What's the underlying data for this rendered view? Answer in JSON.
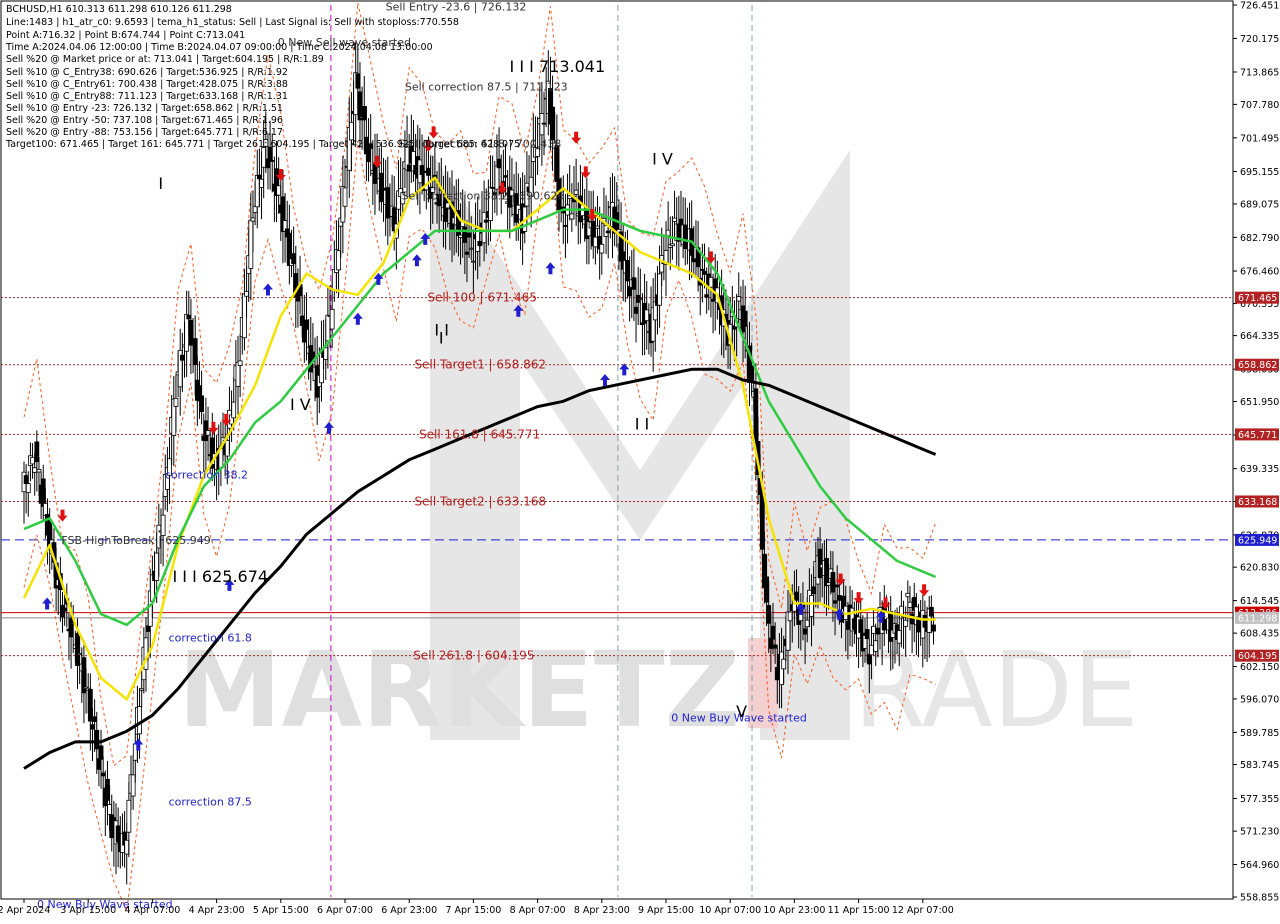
{
  "info": {
    "lines": [
      "BCHUSD,H1  610.313 611.298 610.126 611.298",
      "Line:1483  | h1_atr_c0: 9.6593  | tema_h1_status: Sell  | Last Signal is: Sell with stoploss:770.558",
      "Point A:716.32  | Point B:674.744  | Point C:713.041",
      "Time A:2024.04.06 12:00:00  | Time B:2024.04.07 09:00:00  | Time C:2024.04.08 13:00:00",
      "Sell %20 @ Market price or at: 713.041  | Target:604.195  | R/R:1.89",
      "Sell %10 @ C_Entry38: 690.626  | Target:536.925  | R/R:1.92",
      "Sell %10 @ C_Entry61: 700.438  | Target:428.075  | R/R:3.88",
      "Sell %10 @ C_Entry88: 711.123  | Target:633.168  | R/R:1.31",
      "Sell %10 @ Entry -23: 726.132  | Target:658.862  | R/R:1.51",
      "Sell %20 @ Entry -50: 737.108  | Target:671.465  | R/R:1.96",
      "Sell %20 @ Entry -88: 753.156  | Target:645.771  | R/R:6.17",
      "Target100: 671.465  | Target 161: 645.771  | Target 261: 604.195  | Target 423: 536.925  | Target 685: 428.075"
    ]
  },
  "watermark": {
    "brand": "MARKETZI",
    "suffix": "TRADE"
  },
  "annotations": [
    {
      "text": "Sell Entry -23.6 | 726.132",
      "price": 726.132,
      "time": 6.1,
      "style": "dark"
    },
    {
      "text": "0 New Sell wave started",
      "price": 719.5,
      "time": 4.42,
      "style": "dark"
    },
    {
      "text": "Sell correction 87.5 | 711.123",
      "price": 711.123,
      "time": 6.4,
      "style": "dark"
    },
    {
      "text": "Sell correction 61.8 | 700.438",
      "price": 700.438,
      "time": 6.3,
      "style": "dark"
    },
    {
      "text": "Sell correction 38.2 | 690.626",
      "price": 690.626,
      "time": 6.35,
      "style": "dark"
    },
    {
      "text": "Sell 100 | 671.465",
      "price": 671.465,
      "time": 6.75,
      "style": "red"
    },
    {
      "text": "Sell Target1 | 658.862",
      "price": 658.862,
      "time": 6.55,
      "style": "red"
    },
    {
      "text": "Sell 161.8 | 645.771",
      "price": 645.771,
      "time": 6.62,
      "style": "red"
    },
    {
      "text": "Sell Target2 | 633.168",
      "price": 633.168,
      "time": 6.55,
      "style": "red"
    },
    {
      "text": "Sell  261.8 | 604.195",
      "price": 604.195,
      "time": 6.53,
      "style": "red"
    },
    {
      "text": "FSB-HighToBreak | 625.949",
      "price": 625.949,
      "time": 1.05,
      "style": "dark"
    },
    {
      "text": "correction 38.2",
      "price": 638.2,
      "time": 2.66,
      "style": "blue"
    },
    {
      "text": "correction 61.8",
      "price": 607.6,
      "time": 2.72,
      "style": "blue"
    },
    {
      "text": "correction 87.5",
      "price": 576.8,
      "time": 2.72,
      "style": "blue"
    },
    {
      "text": "0 New Buy Wave started",
      "price": 557.5,
      "time": 0.67,
      "style": "blue"
    },
    {
      "text": "0 New Buy Wave started",
      "price": 592.6,
      "time": 10.55,
      "style": "blue"
    }
  ],
  "wave_labels": [
    {
      "text": "I I I 713.041",
      "price": 715.0,
      "time": 7.75,
      "color": "#000000"
    },
    {
      "text": "I I I 625.674",
      "price": 619.2,
      "time": 2.5,
      "color": "#1f1fd0"
    },
    {
      "text": "I V",
      "price": 651.5,
      "time": 4.33,
      "color": "#1f1fd0"
    },
    {
      "text": "I V",
      "price": 697.6,
      "time": 9.97,
      "color": "#000000"
    },
    {
      "text": "I I",
      "price": 665.5,
      "time": 6.58,
      "color": "#000000"
    },
    {
      "text": "I I",
      "price": 647.8,
      "time": 9.7,
      "color": "#000000"
    },
    {
      "text": "V",
      "price": 593.8,
      "time": 11.28,
      "color": "#000000"
    },
    {
      "text": "I",
      "price": 693.0,
      "time": 2.28,
      "color": "#1f1fd0"
    },
    {
      "text": "I",
      "price": 664.0,
      "time": 6.65,
      "color": "#000000"
    }
  ],
  "price_tags": [
    {
      "label": "671.465",
      "price": 671.465,
      "color": "#b22222"
    },
    {
      "label": "658.862",
      "price": 658.862,
      "color": "#b22222"
    },
    {
      "label": "645.771",
      "price": 645.771,
      "color": "#b22222"
    },
    {
      "label": "633.168",
      "price": 633.168,
      "color": "#b22222"
    },
    {
      "label": "625.949",
      "price": 625.949,
      "color": "#1f1fd0"
    },
    {
      "label": "612.286",
      "price": 612.286,
      "color": "#cc0000"
    },
    {
      "label": "611.298",
      "price": 611.298,
      "color": "#c0c0c0"
    },
    {
      "label": "604.195",
      "price": 604.195,
      "color": "#b22222"
    }
  ],
  "chart_data": {
    "type": "line",
    "symbol": "BCHUSD",
    "timeframe": "H1",
    "y_axis": {
      "min": 558.855,
      "max": 726.451,
      "ticks": [
        "726.451",
        "720.175",
        "713.865",
        "707.780",
        "701.495",
        "695.155",
        "689.075",
        "682.790",
        "676.460",
        "670.355",
        "664.335",
        "658.030",
        "651.950",
        "645.665",
        "639.335",
        "633.155",
        "626.870",
        "620.830",
        "614.545",
        "608.435",
        "602.150",
        "596.070",
        "589.785",
        "583.745",
        "577.355",
        "571.230",
        "564.960",
        "558.855"
      ]
    },
    "x_axis": {
      "labels": [
        "2 Apr 2024",
        "3 Apr 15:00",
        "4 Apr 07:00",
        "4 Apr 23:00",
        "5 Apr 15:00",
        "6 Apr 07:00",
        "6 Apr 23:00",
        "7 Apr 15:00",
        "8 Apr 07:00",
        "8 Apr 23:00",
        "9 Apr 15:00",
        "10 Apr 07:00",
        "10 Apr 23:00",
        "11 Apr 15:00",
        "12 Apr 07:00"
      ]
    },
    "levels": [
      {
        "name": "Sell 100",
        "value": 671.465,
        "color": "#b22222",
        "style": "dotted"
      },
      {
        "name": "Sell Target1",
        "value": 658.862,
        "color": "#b22222",
        "style": "dotted"
      },
      {
        "name": "Sell 161.8",
        "value": 645.771,
        "color": "#b22222",
        "style": "dotted"
      },
      {
        "name": "Sell Target2",
        "value": 633.168,
        "color": "#b22222",
        "style": "dotted"
      },
      {
        "name": "FSB-HighToBreak",
        "value": 625.949,
        "color": "#1f1fd0",
        "style": "dashed"
      },
      {
        "name": "Stop",
        "value": 612.286,
        "color": "#cc0000",
        "style": "solid"
      },
      {
        "name": "Last",
        "value": 611.298,
        "color": "#888888",
        "style": "solid"
      },
      {
        "name": "Sell 261.8",
        "value": 604.195,
        "color": "#b22222",
        "style": "dotted"
      }
    ],
    "vertical_markers": [
      {
        "time": 4.78,
        "color": "#cc00cc",
        "style": "dashed"
      },
      {
        "time": 9.25,
        "color": "#7fa6b8",
        "style": "dashed"
      },
      {
        "time": 11.34,
        "color": "#7fa6b8",
        "style": "dashed"
      }
    ],
    "series": [
      {
        "name": "close",
        "color": "#000000",
        "x": [
          0.0,
          0.2,
          0.4,
          0.6,
          0.8,
          1.0,
          1.2,
          1.4,
          1.6,
          1.8,
          2.0,
          2.2,
          2.4,
          2.6,
          2.8,
          3.0,
          3.2,
          3.4,
          3.6,
          3.8,
          4.0,
          4.2,
          4.4,
          4.6,
          4.8,
          5.0,
          5.2,
          5.4,
          5.6,
          5.8,
          6.0,
          6.2,
          6.4,
          6.6,
          6.8,
          7.0,
          7.2,
          7.4,
          7.6,
          7.8,
          8.0,
          8.2,
          8.4,
          8.6,
          8.8,
          9.0,
          9.2,
          9.4,
          9.6,
          9.8,
          10.0,
          10.2,
          10.4,
          10.6,
          10.8,
          11.0,
          11.2,
          11.4,
          11.6,
          11.8,
          12.0,
          12.2,
          12.4,
          12.6,
          12.8,
          13.0,
          13.2,
          13.4,
          13.6,
          13.8,
          14.0,
          14.2
        ],
        "values": [
          635,
          642,
          628,
          615,
          608,
          598,
          585,
          572,
          568,
          592,
          615,
          632,
          655,
          668,
          648,
          640,
          645,
          662,
          688,
          700,
          690,
          678,
          665,
          655,
          668,
          690,
          712,
          698,
          692,
          685,
          698,
          695,
          692,
          688,
          685,
          680,
          685,
          695,
          690,
          686,
          700,
          710,
          686,
          690,
          685,
          682,
          688,
          676,
          670,
          665,
          680,
          685,
          682,
          675,
          672,
          665,
          670,
          652,
          612,
          600,
          615,
          610,
          622,
          618,
          612,
          610,
          605,
          612,
          608,
          614,
          610,
          611.3
        ]
      },
      {
        "name": "EMA fast",
        "color": "#f5e300",
        "x": [
          0.0,
          0.4,
          0.8,
          1.2,
          1.6,
          2.0,
          2.4,
          2.8,
          3.2,
          3.6,
          4.0,
          4.4,
          4.8,
          5.2,
          5.6,
          6.0,
          6.4,
          6.8,
          7.2,
          7.6,
          8.0,
          8.4,
          8.8,
          9.2,
          9.6,
          10.0,
          10.4,
          10.8,
          11.2,
          11.6,
          12.0,
          12.4,
          12.8,
          13.2,
          13.6,
          14.0,
          14.2
        ],
        "values": [
          615,
          625,
          610,
          600,
          596,
          606,
          625,
          638,
          646,
          655,
          668,
          676,
          673,
          672,
          678,
          690,
          694,
          686,
          684,
          684,
          688,
          692,
          688,
          684,
          680,
          678,
          676,
          672,
          655,
          630,
          614,
          614,
          612,
          613,
          612,
          611,
          611
        ]
      },
      {
        "name": "EMA mid",
        "color": "#2ecc40",
        "x": [
          0.0,
          0.4,
          0.8,
          1.2,
          1.6,
          2.0,
          2.4,
          2.8,
          3.2,
          3.6,
          4.0,
          4.4,
          4.8,
          5.2,
          5.6,
          6.0,
          6.4,
          6.8,
          7.2,
          7.6,
          8.0,
          8.4,
          8.8,
          9.2,
          9.6,
          10.0,
          10.4,
          10.8,
          11.2,
          11.6,
          12.0,
          12.4,
          12.8,
          13.2,
          13.6,
          14.0,
          14.2
        ],
        "values": [
          628,
          630,
          622,
          612,
          610,
          614,
          626,
          636,
          641,
          648,
          652,
          658,
          664,
          670,
          676,
          680,
          684,
          684,
          684,
          684,
          686,
          688,
          688,
          686,
          684,
          683,
          682,
          676,
          664,
          652,
          644,
          636,
          630,
          626,
          622,
          620,
          619
        ]
      },
      {
        "name": "MA slow",
        "color": "#000000",
        "x": [
          0.0,
          0.4,
          0.8,
          1.2,
          1.6,
          2.0,
          2.4,
          2.8,
          3.2,
          3.6,
          4.0,
          4.4,
          4.8,
          5.2,
          5.6,
          6.0,
          6.4,
          6.8,
          7.2,
          7.6,
          8.0,
          8.4,
          8.8,
          9.2,
          9.6,
          10.0,
          10.4,
          10.8,
          11.2,
          11.6,
          12.0,
          12.4,
          12.8,
          13.2,
          13.6,
          14.0,
          14.2
        ],
        "values": [
          583,
          586,
          588,
          588,
          590,
          593,
          598,
          604,
          610,
          616,
          621,
          627,
          631,
          635,
          638,
          641,
          643,
          645,
          647,
          649,
          651,
          652,
          654,
          655,
          656,
          657,
          658,
          658,
          656,
          655,
          653,
          651,
          649,
          647,
          645,
          643,
          642
        ]
      }
    ],
    "arrows": {
      "buy": [
        {
          "time": 0.36,
          "price": 614.0
        },
        {
          "time": 1.78,
          "price": 587.5
        },
        {
          "time": 3.2,
          "price": 617.5
        },
        {
          "time": 3.8,
          "price": 673.0
        },
        {
          "time": 4.75,
          "price": 647.0
        },
        {
          "time": 5.2,
          "price": 667.5
        },
        {
          "time": 5.52,
          "price": 675.0
        },
        {
          "time": 6.12,
          "price": 678.5
        },
        {
          "time": 6.25,
          "price": 682.5
        },
        {
          "time": 7.7,
          "price": 669.0
        },
        {
          "time": 8.2,
          "price": 677.0
        },
        {
          "time": 9.05,
          "price": 656.0
        },
        {
          "time": 9.35,
          "price": 658.0
        },
        {
          "time": 12.1,
          "price": 613.0
        },
        {
          "time": 12.7,
          "price": 612.0
        },
        {
          "time": 13.35,
          "price": 611.5
        }
      ],
      "sell": [
        {
          "time": 0.6,
          "price": 630.5
        },
        {
          "time": 2.95,
          "price": 647.0
        },
        {
          "time": 3.15,
          "price": 648.5
        },
        {
          "time": 4.0,
          "price": 694.5
        },
        {
          "time": 5.5,
          "price": 697.0
        },
        {
          "time": 6.3,
          "price": 700.0
        },
        {
          "time": 6.38,
          "price": 702.5
        },
        {
          "time": 7.45,
          "price": 692.0
        },
        {
          "time": 8.6,
          "price": 701.5
        },
        {
          "time": 8.85,
          "price": 687.0
        },
        {
          "time": 8.75,
          "price": 695.0
        },
        {
          "time": 10.7,
          "price": 679.0
        },
        {
          "time": 12.72,
          "price": 618.5
        },
        {
          "time": 13.0,
          "price": 615.0
        },
        {
          "time": 13.42,
          "price": 614.0
        },
        {
          "time": 14.02,
          "price": 616.5
        }
      ]
    },
    "grid": false,
    "legend": "none"
  }
}
